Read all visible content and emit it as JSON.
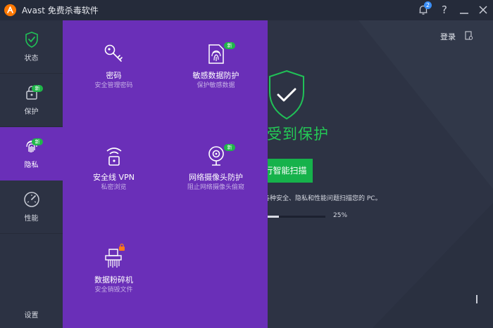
{
  "titlebar": {
    "app_title": "Avast 免费杀毒软件",
    "notification_count": "2",
    "help_label": "?",
    "icons": [
      "avast-logo-icon",
      "bell-icon",
      "help-icon",
      "minimize-icon",
      "close-icon"
    ]
  },
  "sidebar": {
    "items": [
      {
        "label": "状态",
        "icon": "shield-check-icon",
        "badge": ""
      },
      {
        "label": "保护",
        "icon": "lock-icon",
        "badge": "新"
      },
      {
        "label": "隐私",
        "icon": "fingerprint-icon",
        "badge": "新"
      },
      {
        "label": "性能",
        "icon": "speedometer-icon",
        "badge": ""
      }
    ],
    "settings_label": "设置",
    "active": "隐私"
  },
  "privacy_panel": {
    "tiles": [
      {
        "title": "密码",
        "subtitle": "安全管理密码",
        "icon": "key-icon",
        "badge": ""
      },
      {
        "title": "敏感数据防护",
        "subtitle": "保护敏感数据",
        "icon": "document-fingerprint-icon",
        "badge": "新"
      },
      {
        "title": "安全线 VPN",
        "subtitle": "私密浏览",
        "icon": "wifi-lock-icon",
        "badge": ""
      },
      {
        "title": "网络摄像头防护",
        "subtitle": "阻止网络摄像头偷窥",
        "icon": "webcam-icon",
        "badge": "新"
      },
      {
        "title": "数据粉碎机",
        "subtitle": "安全销毁文件",
        "icon": "shredder-icon",
        "badge": ""
      }
    ]
  },
  "main": {
    "login_label": "登录",
    "status_text": "受到保护",
    "scan_button_label": "行智能扫描",
    "scan_description": "各种安全、隐私和性能问题扫描您的 PC。",
    "progress_value": 0.25,
    "progress_label": "25%"
  },
  "colors": {
    "accent_purple": "#6a2fb8",
    "accent_green": "#16b24b",
    "brand_orange": "#ff7800",
    "background": "#2d3344"
  }
}
